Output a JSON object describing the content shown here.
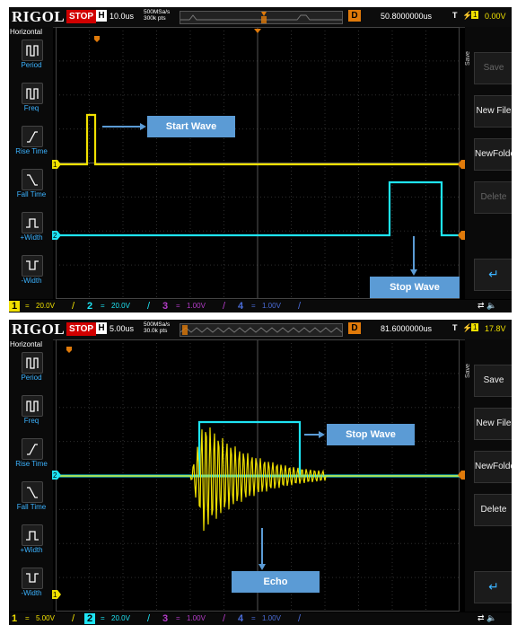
{
  "panels": [
    {
      "brand": "RIGOL",
      "run_state": "STOP",
      "h_label": "H",
      "timebase": "10.0us",
      "sample_rate": "500MSa/s",
      "mem_depth": "300k pts",
      "delay_label": "D",
      "delay_value": "50.8000000us",
      "trigger": {
        "t": "T",
        "edge_icon": "rising-edge-icon",
        "source": "1",
        "level": "0.00V"
      },
      "left_menu": {
        "title": "Horizontal",
        "items": [
          {
            "icon": "period-icon",
            "label": "Period"
          },
          {
            "icon": "freq-icon",
            "label": "Freq"
          },
          {
            "icon": "rise-time-icon",
            "label": "Rise Time"
          },
          {
            "icon": "fall-time-icon",
            "label": "Fall Time"
          },
          {
            "icon": "plus-width-icon",
            "label": "+Width"
          },
          {
            "icon": "minus-width-icon",
            "label": "-Width"
          }
        ]
      },
      "right_menu": {
        "tab": "Save",
        "buttons": [
          {
            "label": "Save",
            "enabled": false
          },
          {
            "label": "New File",
            "enabled": true
          },
          {
            "label": "NewFolder",
            "enabled": true
          },
          {
            "label": "Delete",
            "enabled": false
          }
        ],
        "enter_icon": "enter-icon"
      },
      "channels": [
        {
          "num": "1",
          "coupling": "=",
          "scale": "20.0V",
          "color": "#f0e000",
          "active": true
        },
        {
          "num": "2",
          "coupling": "=",
          "scale": "20.0V",
          "color": "#1ee4f4",
          "active": false
        },
        {
          "num": "3",
          "coupling": "=",
          "scale": "1.00V",
          "color": "#b43cc8",
          "active": false
        },
        {
          "num": "4",
          "coupling": "=",
          "scale": "1.00V",
          "color": "#4a6cd8",
          "active": false
        }
      ],
      "annotations": {
        "a": "Start Wave",
        "b": "Stop Wave"
      },
      "status_icons": [
        "usb-icon",
        "speaker-icon"
      ]
    },
    {
      "brand": "RIGOL",
      "run_state": "STOP",
      "h_label": "H",
      "timebase": "5.00us",
      "sample_rate": "500MSa/s",
      "mem_depth": "30.0k pts",
      "delay_label": "D",
      "delay_value": "81.6000000us",
      "trigger": {
        "t": "T",
        "edge_icon": "rising-edge-icon",
        "source": "1",
        "level": "17.8V"
      },
      "left_menu": {
        "title": "Horizontal",
        "items": [
          {
            "icon": "period-icon",
            "label": "Period"
          },
          {
            "icon": "freq-icon",
            "label": "Freq"
          },
          {
            "icon": "rise-time-icon",
            "label": "Rise Time"
          },
          {
            "icon": "fall-time-icon",
            "label": "Fall Time"
          },
          {
            "icon": "plus-width-icon",
            "label": "+Width"
          },
          {
            "icon": "minus-width-icon",
            "label": "-Width"
          }
        ]
      },
      "right_menu": {
        "tab": "Save",
        "buttons": [
          {
            "label": "Save",
            "enabled": true
          },
          {
            "label": "New File",
            "enabled": true
          },
          {
            "label": "NewFolder",
            "enabled": true
          },
          {
            "label": "Delete",
            "enabled": true
          }
        ],
        "enter_icon": "enter-icon"
      },
      "channels": [
        {
          "num": "1",
          "coupling": "=",
          "scale": "5.00V",
          "color": "#f0e000",
          "active": false
        },
        {
          "num": "2",
          "coupling": "=",
          "scale": "20.0V",
          "color": "#1ee4f4",
          "active": true
        },
        {
          "num": "3",
          "coupling": "=",
          "scale": "1.00V",
          "color": "#b43cc8",
          "active": false
        },
        {
          "num": "4",
          "coupling": "=",
          "scale": "1.00V",
          "color": "#4a6cd8",
          "active": false
        }
      ],
      "annotations": {
        "a": "Stop Wave",
        "b": "Echo"
      },
      "status_icons": [
        "usb-icon",
        "speaker-icon"
      ]
    }
  ]
}
